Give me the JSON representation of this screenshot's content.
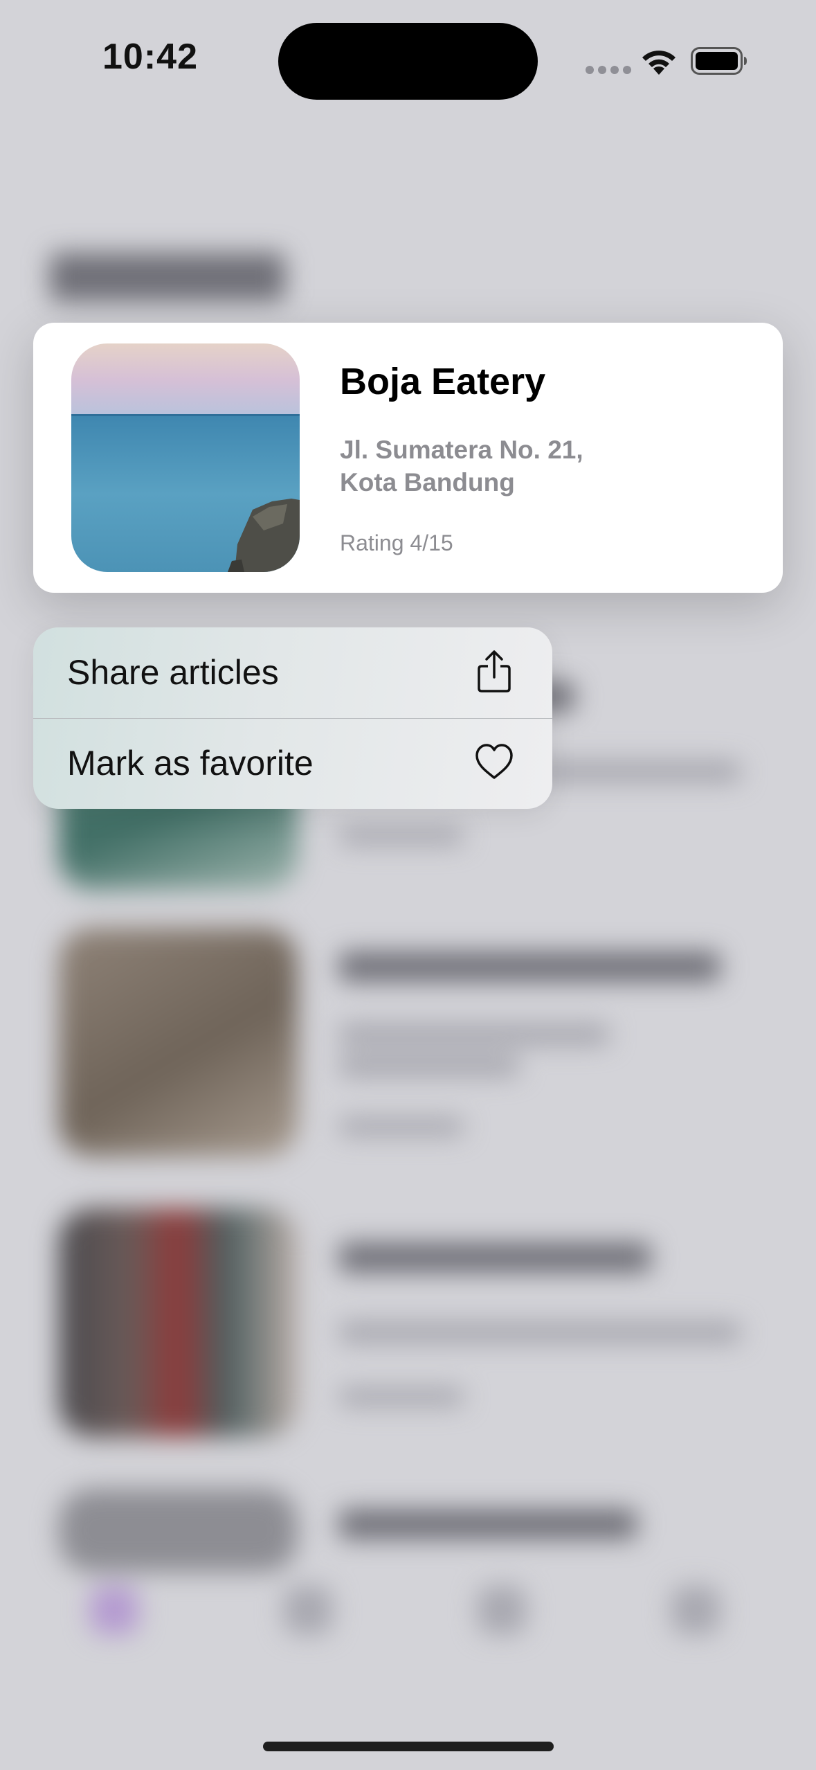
{
  "status_bar": {
    "time": "10:42",
    "icons": [
      "signal-dots-icon",
      "wifi-icon",
      "battery-icon"
    ]
  },
  "preview_card": {
    "name": "Boja Eatery",
    "address_line1": "Jl. Sumatera No. 21,",
    "address_line2": "Kota Bandung",
    "rating": "Rating 4/15",
    "image": "ocean-with-rock-thumbnail"
  },
  "context_menu": {
    "items": [
      {
        "label": "Share articles",
        "icon": "share-icon"
      },
      {
        "label": "Mark as favorite",
        "icon": "heart-icon"
      }
    ]
  },
  "colors": {
    "menu_tint": "#d1e0df",
    "secondary_text": "#8c8c91",
    "background_dim": "#d3d3d8"
  }
}
